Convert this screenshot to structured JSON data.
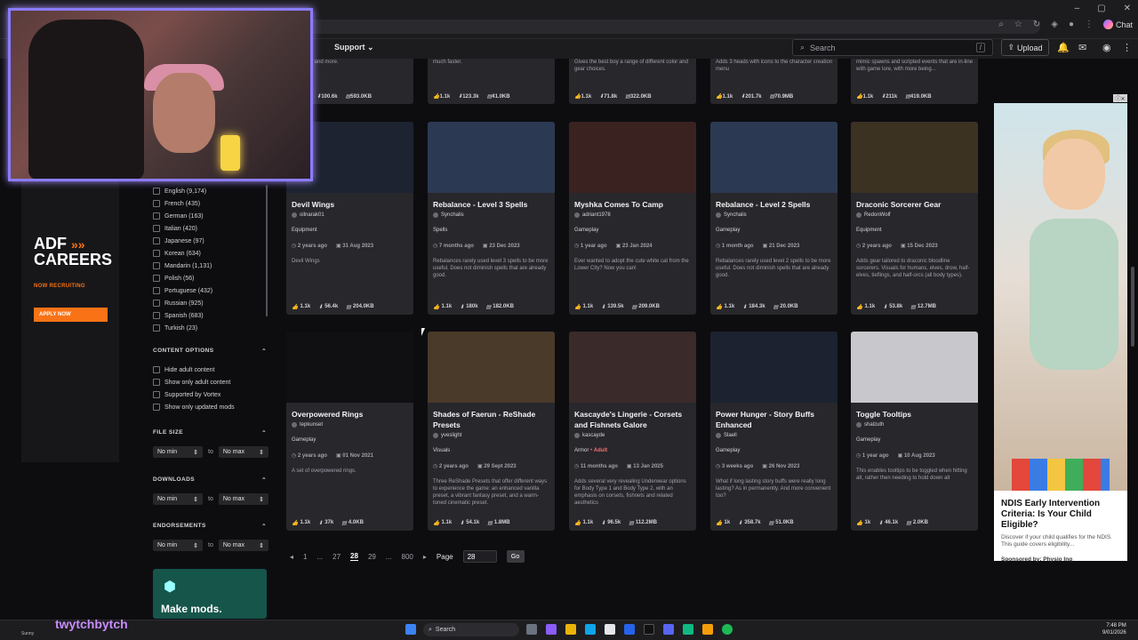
{
  "header": {
    "nav_support": "Support",
    "search_placeholder": "Search",
    "search_shortcut": "/",
    "upload_label": "Upload",
    "chat_label": "Chat"
  },
  "left_ad": {
    "title_line1": "ADF",
    "title_line2": "CAREERS",
    "recruiting": "NOW RECRUITING",
    "apply": "APPLY NOW"
  },
  "languages": [
    {
      "label": "English (9,174)"
    },
    {
      "label": "French (435)"
    },
    {
      "label": "German (163)"
    },
    {
      "label": "Italian (420)"
    },
    {
      "label": "Japanese (97)"
    },
    {
      "label": "Korean (634)"
    },
    {
      "label": "Mandarin (1,131)"
    },
    {
      "label": "Polish (56)"
    },
    {
      "label": "Portuguese (432)"
    },
    {
      "label": "Russian (925)"
    },
    {
      "label": "Spanish (683)"
    },
    {
      "label": "Turkish (23)"
    }
  ],
  "content_options": {
    "heading": "CONTENT OPTIONS",
    "items": [
      {
        "label": "Hide adult content"
      },
      {
        "label": "Show only adult content"
      },
      {
        "label": "Supported by Vortex"
      },
      {
        "label": "Show only updated mods"
      }
    ]
  },
  "filters": {
    "file_size": {
      "heading": "FILE SIZE",
      "min": "No min",
      "max": "No max"
    },
    "downloads": {
      "heading": "DOWNLOADS",
      "min": "No min",
      "max": "No max"
    },
    "endorsements": {
      "heading": "ENDORSEMENTS",
      "min": "No min",
      "max": "No max"
    },
    "to_label": "to"
  },
  "make_mods": "Make mods.",
  "top_partial": [
    {
      "desc": "est items and more.",
      "endorse": "1.1k",
      "downloads": "100.6k",
      "size": "593.0KB"
    },
    {
      "desc": "much faster.",
      "endorse": "1.1k",
      "downloads": "123.3k",
      "size": "41.0KB"
    },
    {
      "desc": "Gives the best boy a range of different color and gear choices.",
      "endorse": "1.1k",
      "downloads": "71.8k",
      "size": "322.0KB"
    },
    {
      "desc": "Adds 3 heads with icons to the character creation menu",
      "endorse": "1.1k",
      "downloads": "201.7k",
      "size": "70.9MB"
    },
    {
      "desc": "mimic spawns and scripted events that are in-line with game lore, with more being...",
      "endorse": "1.1k",
      "downloads": "211k",
      "size": "419.0KB"
    }
  ],
  "mods_row1": [
    {
      "title": "Devil Wings",
      "author": "oilnarak01",
      "category": "Equipment",
      "updated": "2 years ago",
      "uploaded": "31 Aug 2023",
      "desc": "Devil Wings",
      "endorse": "1.1k",
      "downloads": "56.4k",
      "size": "204.0KB",
      "thumb": "#1d2330"
    },
    {
      "title": "Rebalance - Level 3 Spells",
      "author": "Synchalis",
      "category": "Spells",
      "updated": "7 months ago",
      "uploaded": "23 Dec 2023",
      "desc": "Rebalances rarely used level 3 spells to be more useful. Does not diminish spells that are already good.",
      "endorse": "1.1k",
      "downloads": "180k",
      "size": "182.0KB",
      "thumb": "#2b3a52"
    },
    {
      "title": "Myshka Comes To Camp",
      "author": "adriant1978",
      "category": "Gameplay",
      "updated": "1 year ago",
      "uploaded": "23 Jan 2024",
      "desc": "Ever wanted to adopt the cute white cat from the Lower City? Now you can!",
      "endorse": "1.1k",
      "downloads": "139.5k",
      "size": "209.0KB",
      "thumb": "#3a2220"
    },
    {
      "title": "Rebalance - Level 2 Spells",
      "author": "Synchalis",
      "category": "Gameplay",
      "updated": "1 month ago",
      "uploaded": "21 Dec 2023",
      "desc": "Rebalances rarely used level 2 spells to be more useful. Does not diminish spells that are already good.",
      "endorse": "1.1k",
      "downloads": "184.3k",
      "size": "20.0KB",
      "thumb": "#2b3a52"
    },
    {
      "title": "Draconic Sorcerer Gear",
      "author": "RedonWolf",
      "category": "Equipment",
      "updated": "2 years ago",
      "uploaded": "15 Dec 2023",
      "desc": "Adds gear tailored to draconic bloodline sorcerers. Visuals for humans, elves, drow, half-elves, tieflings, and half-orcs (all body types).",
      "endorse": "1.1k",
      "downloads": "53.8k",
      "size": "12.7MB",
      "thumb": "#3b3222"
    }
  ],
  "mods_row2": [
    {
      "title": "Overpowered Rings",
      "author": "tepkunset",
      "category": "Gameplay",
      "adult": "",
      "updated": "2 years ago",
      "uploaded": "01 Nov 2021",
      "desc": "A set of overpowered rings.",
      "endorse": "1.1k",
      "downloads": "37k",
      "size": "4.0KB",
      "thumb": "#101012"
    },
    {
      "title": "Shades of Faerun - ReShade Presets",
      "author": "yveslight",
      "category": "Visuals",
      "adult": "",
      "updated": "2 years ago",
      "uploaded": "29 Sept 2023",
      "desc": "Three ReShade Presets that offer different ways to experience the game: an enhanced vanilla preset, a vibrant fantasy preset, and a warm-toned cinematic preset.",
      "endorse": "1.1k",
      "downloads": "54.1k",
      "size": "1.8MB",
      "thumb": "#4a3a2a"
    },
    {
      "title": "Kascayde's Lingerie - Corsets and Fishnets Galore",
      "author": "kascayde",
      "category": "Armor",
      "adult": "Adult",
      "updated": "11 months ago",
      "uploaded": "13 Jan 2025",
      "desc": "Adds several very revealing Underwear options for Body Type 1 and Body Type 2, with an emphasis on corsets, fishnets and related aesthetics",
      "endorse": "1.1k",
      "downloads": "96.5k",
      "size": "112.2MB",
      "thumb": "#3a2a2a"
    },
    {
      "title": "Power Hunger - Story Buffs Enhanced",
      "author": "Slaell",
      "category": "Gameplay",
      "adult": "",
      "updated": "3 weeks ago",
      "uploaded": "26 Nov 2023",
      "desc": "What if long lasting story buffs were really long lasting? As in permanently. And more convenient too?",
      "endorse": "1k",
      "downloads": "358.7k",
      "size": "51.0KB",
      "thumb": "#1d2230"
    },
    {
      "title": "Toggle Tooltips",
      "author": "shalzuth",
      "category": "Gameplay",
      "adult": "",
      "updated": "1 year ago",
      "uploaded": "10 Aug 2023",
      "desc": "This enables tooltips to be toggled when hitting alt, rather then needing to hold down alt",
      "endorse": "1k",
      "downloads": "46.1k",
      "size": "2.0KB",
      "thumb": "#c8c8cc"
    }
  ],
  "pagination": {
    "pages": [
      "1",
      "...",
      "27",
      "28",
      "29",
      "...",
      "800"
    ],
    "current": "28",
    "page_label": "Page",
    "page_value": "28",
    "go": "Go"
  },
  "right_ad": {
    "headline": "NDIS Early Intervention Criteria: Is Your Child Eligible?",
    "body": "Discover if your child qualifies for the NDIS. This guide covers eligibility...",
    "sponsor": "Sponsored by: Physio Inq"
  },
  "taskbar": {
    "search": "Search",
    "time": "7:48 PM",
    "date": "9/01/2026",
    "user": "Sunny"
  },
  "stream": {
    "name": "twytchbytch"
  },
  "colors": {
    "accent_orange": "#f97316",
    "card_bg": "#27272c",
    "page_bg": "#0d0d10",
    "webcam_border": "#8b7cff"
  }
}
